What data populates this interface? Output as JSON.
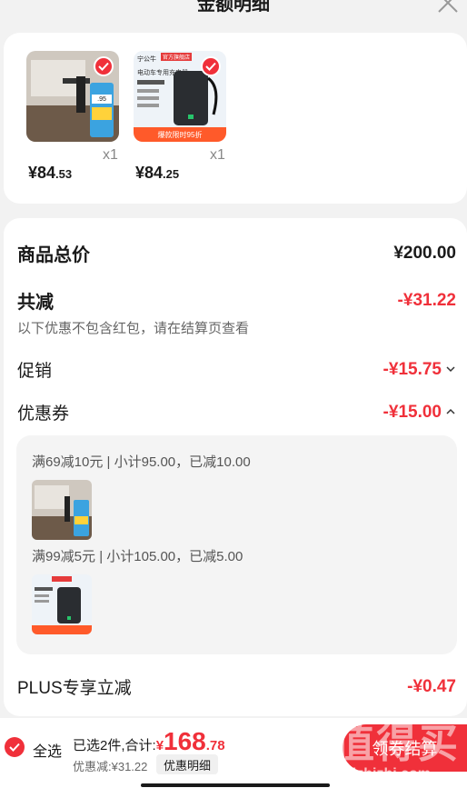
{
  "header": {
    "title": "金额明细"
  },
  "products": [
    {
      "price_int": "¥84",
      "price_dec": ".53",
      "qty": "x1",
      "badge_text": ".95"
    },
    {
      "price_int": "¥84",
      "price_dec": ".25",
      "qty": "x1",
      "brand_text": "宁公牛",
      "ribbon_text": "爆款限时95折",
      "tag_text": "官方旗舰店",
      "product_title": "电动车专用充电器"
    }
  ],
  "details": {
    "total_label": "商品总价",
    "total_value": "¥200.00",
    "reduction_label": "共减",
    "reduction_value": "-¥31.22",
    "reduction_note": "以下优惠不包含红包，请在结算页查看",
    "promo_label": "促销",
    "promo_value": "-¥15.75",
    "coupon_label": "优惠券",
    "coupon_value": "-¥15.00",
    "coupon_lines": [
      "满69减10元 | 小计95.00，已减10.00",
      "满99减5元 | 小计105.00，已减5.00"
    ],
    "plus_label": "PLUS专享立减",
    "plus_value": "-¥0.47"
  },
  "bottom": {
    "select_all": "全选",
    "summary": "已选2件,合计:",
    "total_currency": "¥",
    "total_int": "168",
    "total_dec": ".78",
    "discount": "优惠减:¥31.22",
    "detail_button": "优惠明细",
    "checkout_button": "领券结算"
  },
  "watermark": {
    "text": "值得买",
    "url": "zhizhizhi.com"
  },
  "colors": {
    "accent": "#f0303a",
    "background": "#f2f2f2",
    "card": "#ffffff"
  }
}
